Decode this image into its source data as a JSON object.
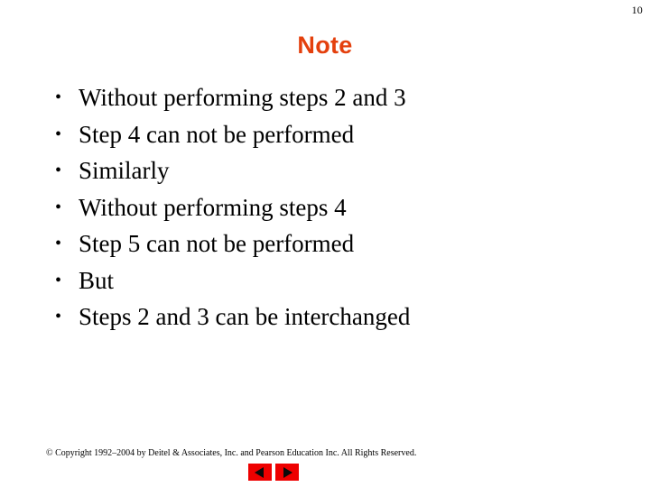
{
  "slide": {
    "page_number": "10",
    "title": "Note",
    "title_color": "#e4400d",
    "background_color": "#ffffff",
    "bullets": [
      {
        "marker": "•",
        "text": "Without performing steps 2 and 3"
      },
      {
        "marker": "•",
        "text": "Step 4 can not be performed"
      },
      {
        "marker": "•",
        "text": "Similarly"
      },
      {
        "marker": "•",
        "text": "Without performing steps 4"
      },
      {
        "marker": "•",
        "text": "Step 5 can not be performed"
      },
      {
        "marker": "•",
        "text": "But"
      },
      {
        "marker": "•",
        "text": "Steps 2 and 3 can be interchanged"
      }
    ]
  },
  "footer": {
    "copyright": "© Copyright 1992–2004 by Deitel & Associates, Inc. and Pearson Education Inc. All Rights Reserved.",
    "nav": {
      "prev_icon": "triangle-left-icon",
      "next_icon": "triangle-right-icon",
      "button_color": "#ee0000",
      "glyph_color": "#0a0a0a"
    }
  }
}
